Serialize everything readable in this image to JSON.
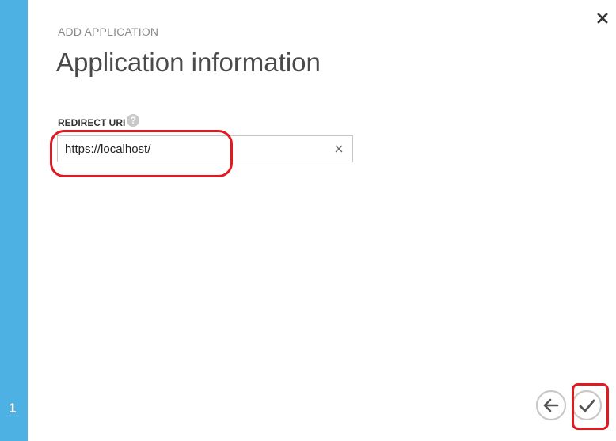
{
  "wizard": {
    "step_number": "1",
    "eyebrow": "ADD APPLICATION",
    "title": "Application information"
  },
  "form": {
    "redirect_uri": {
      "label": "REDIRECT URI",
      "help_icon": "question-mark-icon",
      "value": "https://localhost/",
      "clear_icon": "clear-x-icon"
    }
  },
  "footer": {
    "back_icon": "arrow-left-icon",
    "confirm_icon": "checkmark-icon"
  },
  "header": {
    "close_icon": "close-icon"
  },
  "colors": {
    "sidebar": "#4db2e3",
    "annotation": "#e11a22",
    "button_border": "#c8c8c8"
  }
}
